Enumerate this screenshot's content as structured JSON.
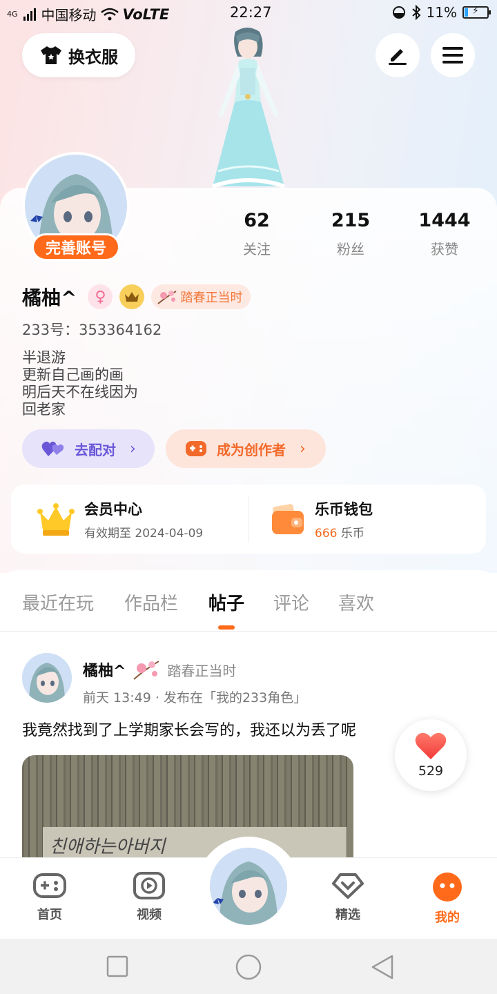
{
  "status_bar": {
    "signal": "4G",
    "carrier": "中国移动",
    "volte": "VoLTE",
    "time": "22:27",
    "battery": "11%"
  },
  "header": {
    "outfit_label": "换衣服"
  },
  "profile": {
    "complete_label": "完善账号",
    "name": "橘柚^",
    "spring_badge": "踏春正当时",
    "uid": "233号：353364162",
    "bio": [
      "半退游",
      "更新自己画的画",
      "明后天不在线因为",
      "回老家"
    ],
    "stats": [
      {
        "value": "62",
        "label": "关注"
      },
      {
        "value": "215",
        "label": "粉丝"
      },
      {
        "value": "1444",
        "label": "获赞"
      }
    ],
    "match_label": "去配对",
    "creator_label": "成为创作者"
  },
  "cards": {
    "vip_title": "会员中心",
    "vip_sub": "有效期至 2024-04-09",
    "wallet_title": "乐币钱包",
    "wallet_amount": "666",
    "wallet_unit": "乐币"
  },
  "tabs": [
    "最近在玩",
    "作品栏",
    "帖子",
    "评论",
    "喜欢"
  ],
  "active_tab": "帖子",
  "post": {
    "author": "橘柚^",
    "badge": "踏春正当时",
    "time": "前天 13:49",
    "location": "发布在「我的233角色」",
    "text": "我竟然找到了上学期家长会写的，我还以为丢了呢",
    "image_text": "친애하는아버지",
    "likes": "529"
  },
  "bottom_nav": [
    {
      "label": "首页",
      "icon": "gamepad-icon"
    },
    {
      "label": "视频",
      "icon": "play-icon"
    },
    {
      "label": "精选",
      "icon": "heart-badge-icon"
    },
    {
      "label": "我的",
      "icon": "face-icon"
    }
  ],
  "colors": {
    "accent": "#ff6a1a",
    "match": "#6a57d8",
    "muted": "#999999"
  }
}
